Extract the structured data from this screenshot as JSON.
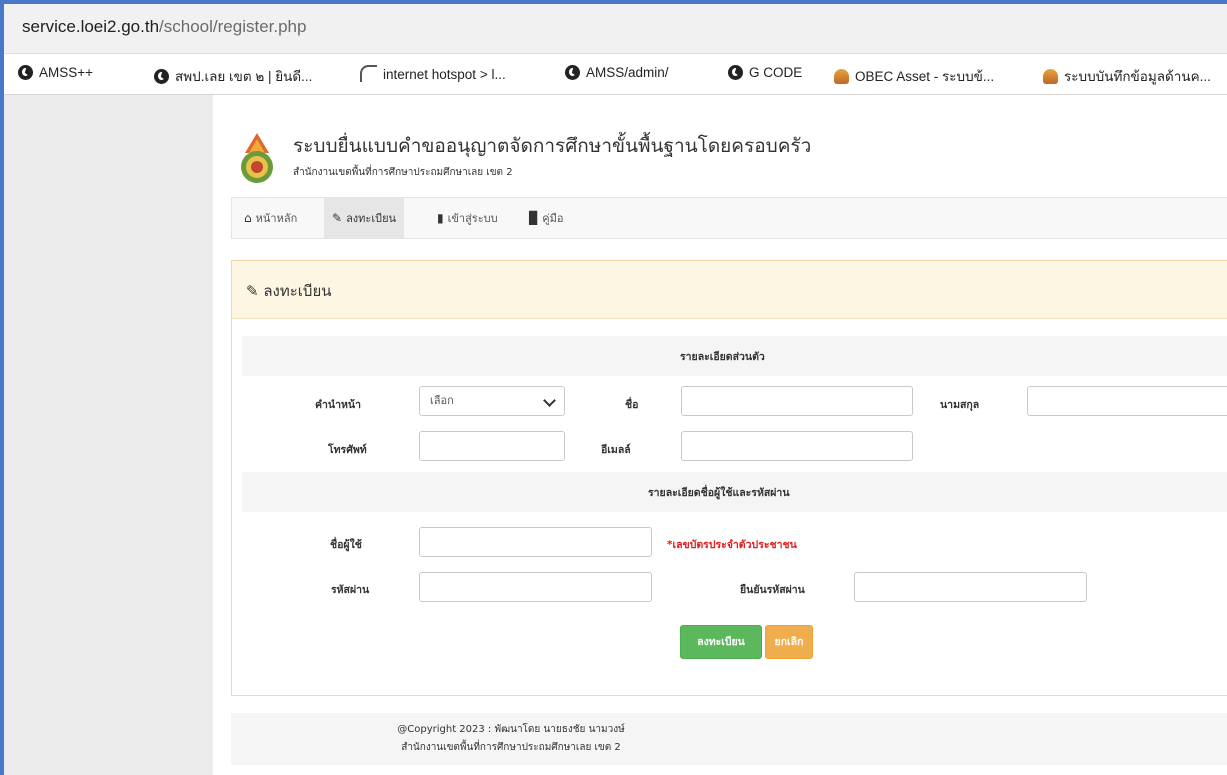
{
  "browser": {
    "url_host": "service.loei2.go.th",
    "url_path": "/school/register.php",
    "bookmarks": [
      {
        "label": "AMSS++",
        "icon": "globe-icon"
      },
      {
        "label": "สพป.เลย เขต ๒ | ยินดี...",
        "icon": "globe-icon"
      },
      {
        "label": "internet hotspot > l...",
        "icon": "wifi-icon"
      },
      {
        "label": "AMSS/admin/",
        "icon": "globe-icon"
      },
      {
        "label": "G CODE",
        "icon": "globe-icon"
      },
      {
        "label": "OBEC Asset - ระบบข้...",
        "icon": "flame-icon"
      },
      {
        "label": "ระบบบันทึกข้อมูลด้านค...",
        "icon": "flame-icon"
      }
    ]
  },
  "site": {
    "title": "ระบบยื่นแบบคำขออนุญาตจัดการศึกษาขั้นพื้นฐานโดยครอบครัว",
    "subtitle": "สำนักงานเขตพื้นที่การศึกษาประถมศึกษาเลย เขต 2"
  },
  "nav": {
    "home": "หน้าหลัก",
    "register": "ลงทะเบียน",
    "login": "เข้าสู่ระบบ",
    "manual": "คู่มือ"
  },
  "form": {
    "panel_title": "ลงทะเบียน",
    "section_personal": "รายละเอียดส่วนตัว",
    "prefix_label": "คำนำหน้า",
    "prefix_selected": "เลือก",
    "firstname_label": "ชื่อ",
    "lastname_label": "นามสกุล",
    "phone_label": "โทรศัพท์",
    "email_label": "อีเมลล์",
    "section_account": "รายละเอียดชื่อผู้ใช้และรหัสผ่าน",
    "username_label": "ชื่อผู้ใช้",
    "username_hint": "*เลขบัตรประจำตัวประชาชน",
    "password_label": "รหัสผ่าน",
    "confirm_label": "ยืนยันรหัสผ่าน",
    "submit": "ลงทะเบียน",
    "cancel": "ยกเลิก"
  },
  "footer": {
    "line1": "@Copyright 2023 : พัฒนาโดย นายธงชัย นามวงษ์",
    "line2": "สำนักงานเขตพื้นที่การศึกษาประถมศึกษาเลย เขต 2"
  },
  "colors": {
    "accent_green": "#5cb85c",
    "accent_orange": "#f0ad4e",
    "warning_bg": "#fcf6e3",
    "hint_red": "#e02020"
  }
}
